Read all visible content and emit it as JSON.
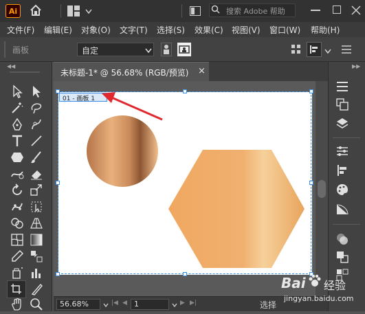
{
  "app": {
    "logo": "Ai"
  },
  "titlebar": {
    "search_placeholder": "搜索 Adobe 帮助"
  },
  "menu": [
    "文件(F)",
    "编辑(E)",
    "对象(O)",
    "文字(T)",
    "选择(S)",
    "效果(C)",
    "视图(V)",
    "窗口(W)",
    "帮助(H)"
  ],
  "control_bar": {
    "artboard_label": "画板",
    "preset_value": "自定"
  },
  "document": {
    "tab_label": "未标题-1* @ 56.68% (RGB/预览)",
    "close_symbol": "×"
  },
  "artboard": {
    "name_tag": "01 - 画板 1"
  },
  "status_bar": {
    "zoom_value": "56.68%",
    "page_value": "1",
    "status_text": "选择"
  },
  "watermark": {
    "brand": "Bai",
    "brand_suffix": "经验",
    "url": "jingyan.baidu.com"
  },
  "colors": {
    "arrow": "#e0282e",
    "circle_gradient": [
      "#b5754a",
      "#e9b07c",
      "#8c5533",
      "#f2c08c"
    ],
    "hexagon_gradient": [
      "#f0a860",
      "#f6c98a",
      "#f0b070",
      "#e8a45c"
    ]
  }
}
